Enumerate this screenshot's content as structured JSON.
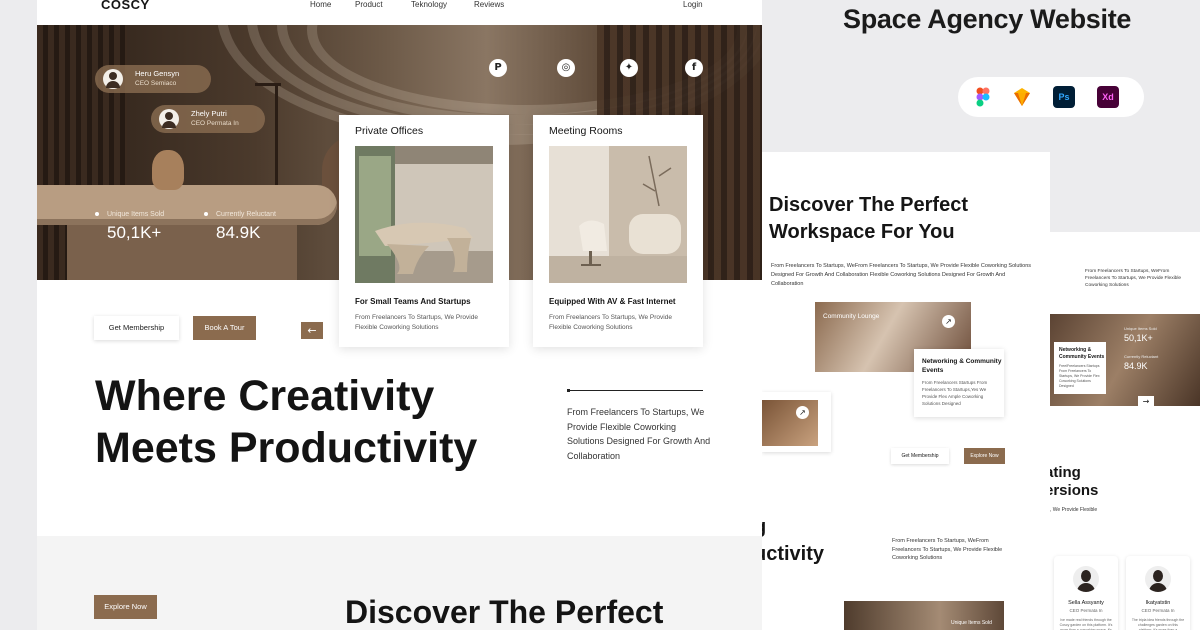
{
  "brand": "COSCY",
  "nav": {
    "home": "Home",
    "product": "Product",
    "teknology": "Teknology",
    "reviews": "Reviews",
    "login": "Login"
  },
  "people": [
    {
      "name": "Heru Gensyn",
      "role": "CEO Semiaco"
    },
    {
      "name": "Zhely Putri",
      "role": "CEO Permata In"
    }
  ],
  "social_icons": [
    "pinterest-icon",
    "instagram-icon",
    "twitter-icon",
    "facebook-icon"
  ],
  "stats": [
    {
      "label": "Unique Items Sold",
      "value": "50,1K+"
    },
    {
      "label": "Currently Reluctant",
      "value": "84.9K"
    }
  ],
  "cards": [
    {
      "title": "Private Offices",
      "subtitle": "For Small Teams And Startups",
      "desc": "From Freelancers To Startups, We Provide Flexible Coworking Solutions"
    },
    {
      "title": "Meeting Rooms",
      "subtitle": "Equipped With AV & Fast Internet",
      "desc": "From Freelancers To Startups, We Provide Flexible Coworking Solutions"
    }
  ],
  "buttons": {
    "membership": "Get Membership",
    "tour": "Book A Tour",
    "explore": "Explore Now",
    "arrow": "←"
  },
  "headline": {
    "line1": "Where Creativity",
    "line2": "Meets Productivity"
  },
  "tagline": "From Freelancers To Startups, We Provide Flexible Coworking Solutions Designed For Growth And Collaboration",
  "discover_title": "Discover The Perfect",
  "showcase_title": "Space Agency Website",
  "tools": [
    {
      "icon": "figma-icon",
      "label": ""
    },
    {
      "icon": "sketch-icon",
      "label": ""
    },
    {
      "icon": "photoshop-icon",
      "label": "Ps"
    },
    {
      "icon": "xd-icon",
      "label": "Xd"
    }
  ],
  "preview2": {
    "title": "Discover The Perfect Workspace For You",
    "desc": "From Freelancers To Startups, WeFrom Freelancers To Startups, We Provide Flexible Coworking Solutions Designed For Growth And Collaboration Flexible Coworking Solutions Designed For Growth And Collaboration",
    "photo_label": "Community Lounge",
    "net_title": "Networking & Community Events",
    "net_desc": "From Freelancers Startups From Freelancers To Startups,Yes We Provide Flex Ample Coworking Solutions Designed",
    "get_membership": "Get Membership",
    "explore_now": "Explore Now",
    "big_line1": "g",
    "big_line2": "uctivity",
    "big_desc": "From Freelancers To Startups, WeFrom Freelancers To Startups, We Provide Flexible Coworking Solutions",
    "bottom_label": "Unique Items Sold"
  },
  "preview3": {
    "desc": "From Freelancers To Startups, WeFrom Freelancers To Startups, We Provide Flexible Coworking Solutions",
    "net_title": "Networking & Community Events",
    "net_desc": "FreelFreelancers Startups From Freelancers To Startups, We Provide Flex Coworking Solutions Designed",
    "stat1_label": "Unique Items Sold",
    "stat1_value": "50,1K+",
    "stat2_label": "Currently Reluctant",
    "stat2_value": "84.9K",
    "big_line1": "ating",
    "big_line2": "ersions",
    "flex": ", We Provide Flexible",
    "testimonials": [
      {
        "name": "Sella Assyanty",
        "role": "CEO Permata In",
        "quote": "Ive made real friends through the Coscy garden on this platform. It's more than a coworking space, it's a community."
      },
      {
        "name": "Ikatyatstin",
        "role": "CEO Permata In",
        "quote": "The tripla idea friends through the challenges garden on this platform, it's more than a coworking space, it's a community."
      }
    ]
  },
  "colors": {
    "accent": "#8b6b4e",
    "text": "#151515",
    "background": "#ececee"
  }
}
